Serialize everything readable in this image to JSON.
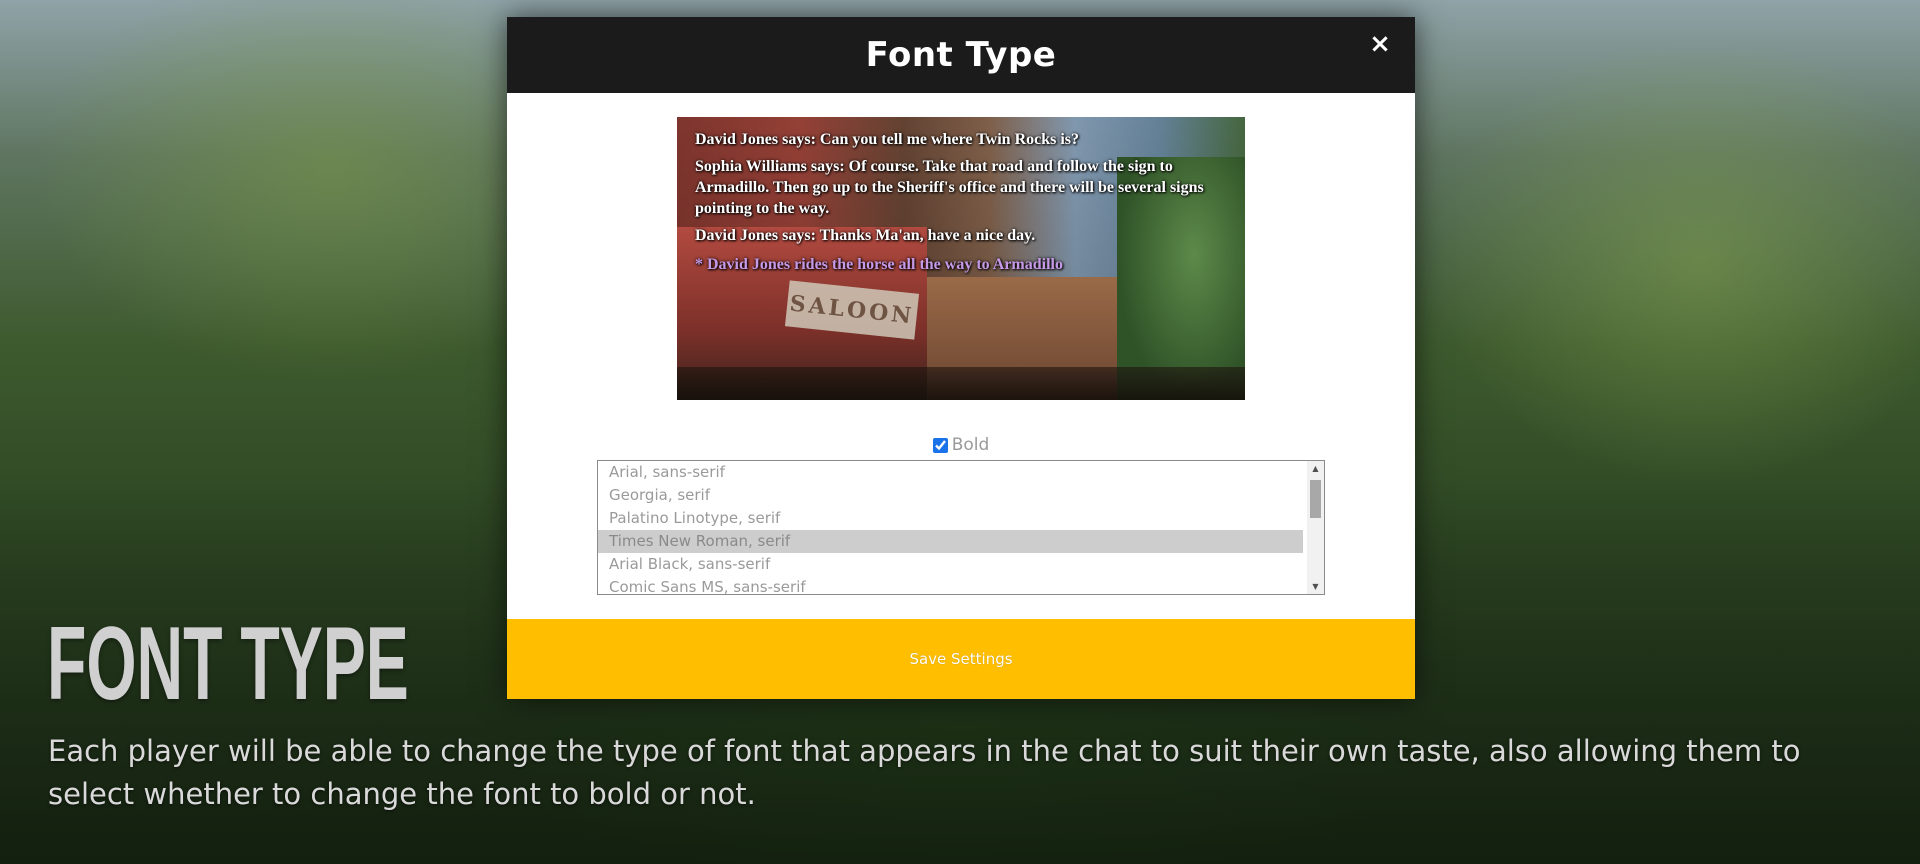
{
  "modal": {
    "title": "Font Type",
    "close_icon": "×"
  },
  "preview": {
    "sign_text": "SALOON",
    "chat_lines": [
      "David Jones says: Can you tell me where Twin Rocks is?",
      "Sophia Williams says: Of course. Take that road and follow the sign to Armadillo. Then go up to the Sheriff's office and there will be several signs pointing to the way.",
      "David Jones says: Thanks Ma'an, have a nice day.",
      "* David Jones rides the horse all the way to Armadillo"
    ],
    "narrate_color": "#c79ae8"
  },
  "bold": {
    "label": "Bold",
    "checked": true
  },
  "font_list": {
    "options": [
      "Arial, sans-serif",
      "Georgia, serif",
      "Palatino Linotype, serif",
      "Times New Roman, serif",
      "Arial Black, sans-serif",
      "Comic Sans MS, sans-serif"
    ],
    "selected": "Times New Roman, serif",
    "scroll_up_icon": "▲",
    "scroll_down_icon": "▼"
  },
  "save_button": {
    "label": "Save Settings",
    "color": "#ffbf00"
  },
  "section": {
    "heading": "FONT TYPE",
    "description": "Each player will be able to change the type of font that appears in the chat to suit their own taste, also allowing them to select whether to change the font to bold or not."
  }
}
